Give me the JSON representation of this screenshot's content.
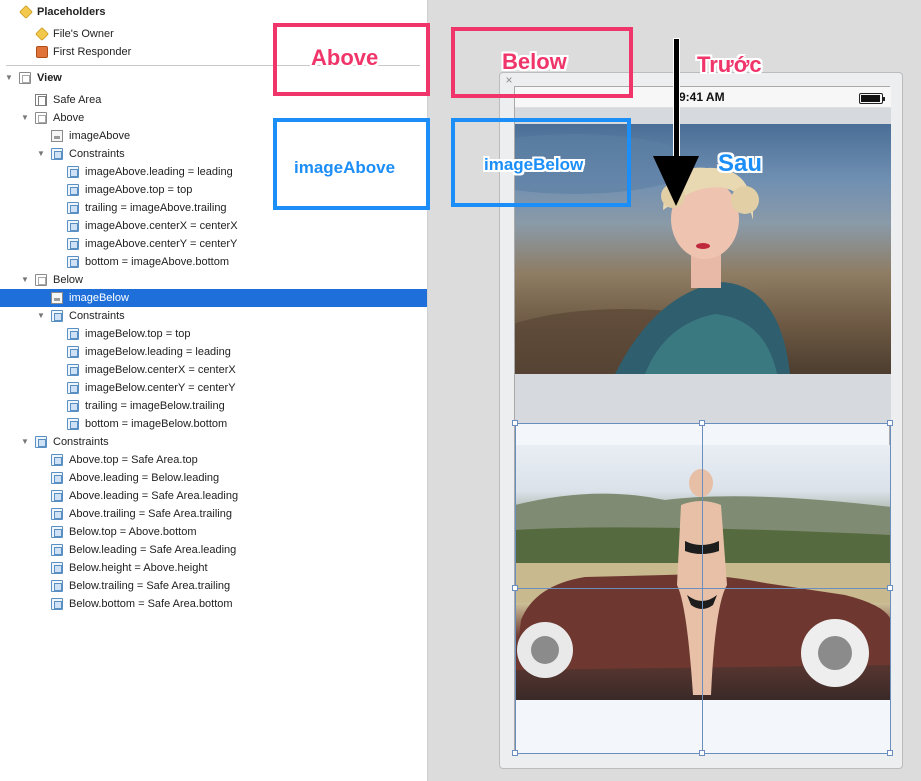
{
  "outline": {
    "placeholders": "Placeholders",
    "files_owner": "File's Owner",
    "first_responder": "First Responder",
    "view": "View",
    "safe_area": "Safe Area",
    "above": "Above",
    "image_above": "imageAbove",
    "constraints": "Constraints",
    "above_constraints": [
      "imageAbove.leading = leading",
      "imageAbove.top = top",
      "trailing = imageAbove.trailing",
      "imageAbove.centerX = centerX",
      "imageAbove.centerY = centerY",
      "bottom = imageAbove.bottom"
    ],
    "below": "Below",
    "image_below": "imageBelow",
    "below_constraints": [
      "imageBelow.top = top",
      "imageBelow.leading = leading",
      "imageBelow.centerX = centerX",
      "imageBelow.centerY = centerY",
      "trailing = imageBelow.trailing",
      "bottom = imageBelow.bottom"
    ],
    "view_constraints": [
      "Above.top = Safe Area.top",
      "Above.leading = Below.leading",
      "Above.leading = Safe Area.leading",
      "Above.trailing = Safe Area.trailing",
      "Below.top = Above.bottom",
      "Below.leading = Safe Area.leading",
      "Below.height = Above.height",
      "Below.trailing = Safe Area.trailing",
      "Below.bottom = Safe Area.bottom"
    ]
  },
  "device": {
    "time": "9:41 AM",
    "close_glyph": "×"
  },
  "annotations": {
    "above": "Above",
    "below": "Below",
    "image_above": "imageAbove",
    "image_below": "imageBelow",
    "truoc": "Trước",
    "sau": "Sau"
  },
  "colors": {
    "selection": "#1e6fd9",
    "annotation_pink": "#f0356a",
    "annotation_blue": "#1c8ef7"
  }
}
